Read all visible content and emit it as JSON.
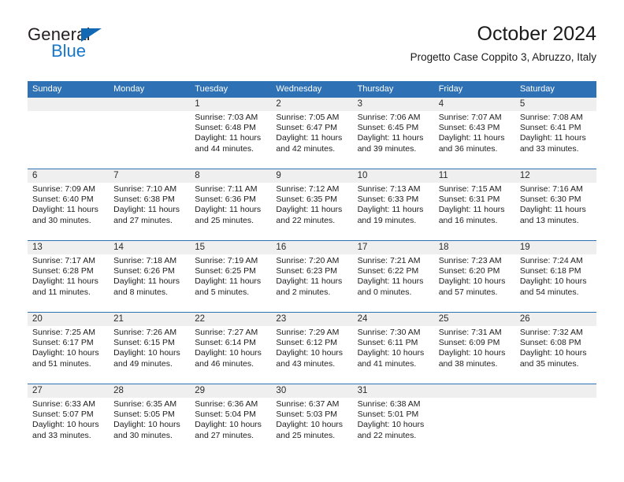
{
  "logo": {
    "word1": "General",
    "word2": "Blue",
    "accent_color": "#1268b3",
    "blue_text_color": "#1877c9"
  },
  "header": {
    "title": "October 2024",
    "subtitle": "Progetto Case Coppito 3, Abruzzo, Italy"
  },
  "calendar": {
    "header_color": "#2e71b5",
    "datestrip_color": "#efefef",
    "weekdays": [
      "Sunday",
      "Monday",
      "Tuesday",
      "Wednesday",
      "Thursday",
      "Friday",
      "Saturday"
    ],
    "weeks": [
      [
        {
          "day": "",
          "info": ""
        },
        {
          "day": "",
          "info": ""
        },
        {
          "day": "1",
          "info": "Sunrise: 7:03 AM\nSunset: 6:48 PM\nDaylight: 11 hours\nand 44 minutes."
        },
        {
          "day": "2",
          "info": "Sunrise: 7:05 AM\nSunset: 6:47 PM\nDaylight: 11 hours\nand 42 minutes."
        },
        {
          "day": "3",
          "info": "Sunrise: 7:06 AM\nSunset: 6:45 PM\nDaylight: 11 hours\nand 39 minutes."
        },
        {
          "day": "4",
          "info": "Sunrise: 7:07 AM\nSunset: 6:43 PM\nDaylight: 11 hours\nand 36 minutes."
        },
        {
          "day": "5",
          "info": "Sunrise: 7:08 AM\nSunset: 6:41 PM\nDaylight: 11 hours\nand 33 minutes."
        }
      ],
      [
        {
          "day": "6",
          "info": "Sunrise: 7:09 AM\nSunset: 6:40 PM\nDaylight: 11 hours\nand 30 minutes."
        },
        {
          "day": "7",
          "info": "Sunrise: 7:10 AM\nSunset: 6:38 PM\nDaylight: 11 hours\nand 27 minutes."
        },
        {
          "day": "8",
          "info": "Sunrise: 7:11 AM\nSunset: 6:36 PM\nDaylight: 11 hours\nand 25 minutes."
        },
        {
          "day": "9",
          "info": "Sunrise: 7:12 AM\nSunset: 6:35 PM\nDaylight: 11 hours\nand 22 minutes."
        },
        {
          "day": "10",
          "info": "Sunrise: 7:13 AM\nSunset: 6:33 PM\nDaylight: 11 hours\nand 19 minutes."
        },
        {
          "day": "11",
          "info": "Sunrise: 7:15 AM\nSunset: 6:31 PM\nDaylight: 11 hours\nand 16 minutes."
        },
        {
          "day": "12",
          "info": "Sunrise: 7:16 AM\nSunset: 6:30 PM\nDaylight: 11 hours\nand 13 minutes."
        }
      ],
      [
        {
          "day": "13",
          "info": "Sunrise: 7:17 AM\nSunset: 6:28 PM\nDaylight: 11 hours\nand 11 minutes."
        },
        {
          "day": "14",
          "info": "Sunrise: 7:18 AM\nSunset: 6:26 PM\nDaylight: 11 hours\nand 8 minutes."
        },
        {
          "day": "15",
          "info": "Sunrise: 7:19 AM\nSunset: 6:25 PM\nDaylight: 11 hours\nand 5 minutes."
        },
        {
          "day": "16",
          "info": "Sunrise: 7:20 AM\nSunset: 6:23 PM\nDaylight: 11 hours\nand 2 minutes."
        },
        {
          "day": "17",
          "info": "Sunrise: 7:21 AM\nSunset: 6:22 PM\nDaylight: 11 hours\nand 0 minutes."
        },
        {
          "day": "18",
          "info": "Sunrise: 7:23 AM\nSunset: 6:20 PM\nDaylight: 10 hours\nand 57 minutes."
        },
        {
          "day": "19",
          "info": "Sunrise: 7:24 AM\nSunset: 6:18 PM\nDaylight: 10 hours\nand 54 minutes."
        }
      ],
      [
        {
          "day": "20",
          "info": "Sunrise: 7:25 AM\nSunset: 6:17 PM\nDaylight: 10 hours\nand 51 minutes."
        },
        {
          "day": "21",
          "info": "Sunrise: 7:26 AM\nSunset: 6:15 PM\nDaylight: 10 hours\nand 49 minutes."
        },
        {
          "day": "22",
          "info": "Sunrise: 7:27 AM\nSunset: 6:14 PM\nDaylight: 10 hours\nand 46 minutes."
        },
        {
          "day": "23",
          "info": "Sunrise: 7:29 AM\nSunset: 6:12 PM\nDaylight: 10 hours\nand 43 minutes."
        },
        {
          "day": "24",
          "info": "Sunrise: 7:30 AM\nSunset: 6:11 PM\nDaylight: 10 hours\nand 41 minutes."
        },
        {
          "day": "25",
          "info": "Sunrise: 7:31 AM\nSunset: 6:09 PM\nDaylight: 10 hours\nand 38 minutes."
        },
        {
          "day": "26",
          "info": "Sunrise: 7:32 AM\nSunset: 6:08 PM\nDaylight: 10 hours\nand 35 minutes."
        }
      ],
      [
        {
          "day": "27",
          "info": "Sunrise: 6:33 AM\nSunset: 5:07 PM\nDaylight: 10 hours\nand 33 minutes."
        },
        {
          "day": "28",
          "info": "Sunrise: 6:35 AM\nSunset: 5:05 PM\nDaylight: 10 hours\nand 30 minutes."
        },
        {
          "day": "29",
          "info": "Sunrise: 6:36 AM\nSunset: 5:04 PM\nDaylight: 10 hours\nand 27 minutes."
        },
        {
          "day": "30",
          "info": "Sunrise: 6:37 AM\nSunset: 5:03 PM\nDaylight: 10 hours\nand 25 minutes."
        },
        {
          "day": "31",
          "info": "Sunrise: 6:38 AM\nSunset: 5:01 PM\nDaylight: 10 hours\nand 22 minutes."
        },
        {
          "day": "",
          "info": ""
        },
        {
          "day": "",
          "info": ""
        }
      ]
    ]
  }
}
